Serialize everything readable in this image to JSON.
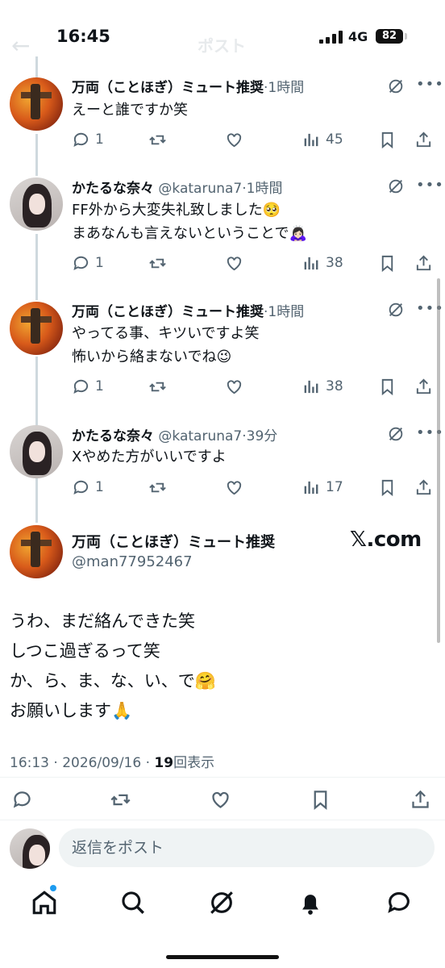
{
  "status_bar": {
    "time": "16:45",
    "network": "4G",
    "battery": "82"
  },
  "header": {
    "faded_title": "ポスト"
  },
  "replies": [
    {
      "name": "万両（ことほぎ）ミュート推奨",
      "handle": "",
      "meta": "·1時間",
      "text": "えーと誰ですか笑",
      "reply_count": "1",
      "view_count": "45"
    },
    {
      "name": "かたるな奈々",
      "handle": "@kataruna7",
      "meta": "·1時間",
      "text": "FF外から大変失礼致しました🥺\nまあなんも言えないということで🙇🏻‍♀️",
      "reply_count": "1",
      "view_count": "38"
    },
    {
      "name": "万両（ことほぎ）ミュート推奨",
      "handle": "",
      "meta": "·1時間",
      "text": "やってる事、キツいですよ笑\n怖いから絡まないでね😉",
      "reply_count": "1",
      "view_count": "38"
    },
    {
      "name": "かたるな奈々",
      "handle": "@kataruna7",
      "meta": "·39分",
      "text": "Xやめた方がいいですよ",
      "reply_count": "1",
      "view_count": "17"
    }
  ],
  "main_post": {
    "name": "万両（ことほぎ）ミュート推奨",
    "handle": "@man77952467",
    "watermark": "𝕏.com",
    "text": "うわ、まだ絡んできた笑\nしつこ過ぎるって笑\nか、ら、ま、な、い、で🤗\nお願いします🙏",
    "timestamp": "16:13 · 2026/09/16 · ",
    "views_number": "19",
    "views_label": "回表示"
  },
  "reply_composer": {
    "placeholder": "返信をポスト"
  },
  "colors": {
    "accent": "#1d9bf0",
    "text": "#0f1419",
    "secondary": "#536471",
    "divider": "#eff3f4"
  }
}
